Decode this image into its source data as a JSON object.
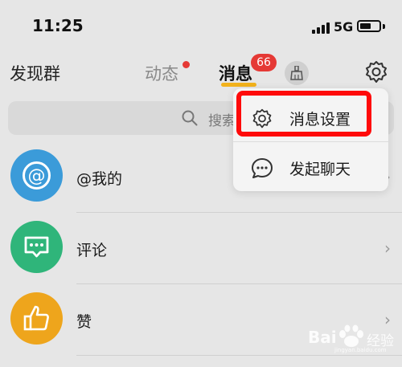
{
  "status_bar": {
    "time": "11:25",
    "network": "5G",
    "battery_level": 0.6
  },
  "tabs": {
    "discover": "发现群",
    "feed": "动态",
    "messages": "消息",
    "messages_badge": "66"
  },
  "search": {
    "placeholder": "搜索"
  },
  "list": [
    {
      "label": "@我的",
      "icon": "at-icon",
      "color": "#3b9bd9"
    },
    {
      "label": "评论",
      "icon": "comment-icon",
      "color": "#2fb57a"
    },
    {
      "label": "赞",
      "icon": "thumbs-up-icon",
      "color": "#eea51c"
    }
  ],
  "dropdown": {
    "items": [
      {
        "label": "消息设置",
        "icon": "gear-icon"
      },
      {
        "label": "发起聊天",
        "icon": "chat-bubble-icon"
      }
    ],
    "highlight_color": "#ff0a0a"
  },
  "watermark": {
    "brand": "Bai",
    "product": "经验",
    "url": "jingyan.baidu.com"
  }
}
